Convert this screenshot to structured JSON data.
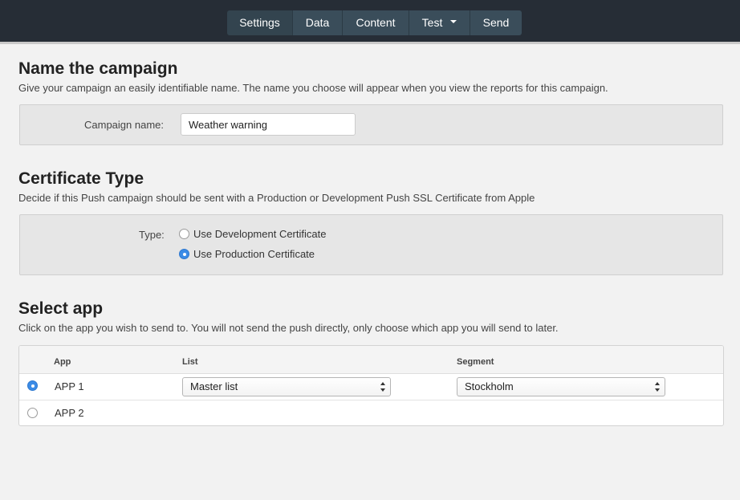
{
  "nav": {
    "tabs": [
      {
        "label": "Settings"
      },
      {
        "label": "Data"
      },
      {
        "label": "Content"
      },
      {
        "label": "Test",
        "dropdown": true
      },
      {
        "label": "Send"
      }
    ]
  },
  "name_section": {
    "title": "Name the campaign",
    "description": "Give your campaign an easily identifiable name. The name you choose will appear when you view the reports for this campaign.",
    "field_label": "Campaign name:",
    "field_value": "Weather warning"
  },
  "cert_section": {
    "title": "Certificate Type",
    "description": "Decide if this Push campaign should be sent with a Production or Development Push SSL Certificate from Apple",
    "type_label": "Type:",
    "options": [
      {
        "label": "Use Development Certificate",
        "selected": false
      },
      {
        "label": "Use Production Certificate",
        "selected": true
      }
    ]
  },
  "app_section": {
    "title": "Select app",
    "description": "Click on the app you wish to send to. You will not send the push directly, only choose which app you will send to later.",
    "columns": {
      "app": "App",
      "list": "List",
      "segment": "Segment"
    },
    "rows": [
      {
        "app": "APP 1",
        "selected": true,
        "list": "Master list",
        "segment": "Stockholm"
      },
      {
        "app": "APP 2",
        "selected": false
      }
    ]
  },
  "colors": {
    "topbar": "#262d36",
    "tab": "#3a4d5a",
    "radio_selected": "#3b8be6",
    "panel": "#e6e6e6"
  }
}
